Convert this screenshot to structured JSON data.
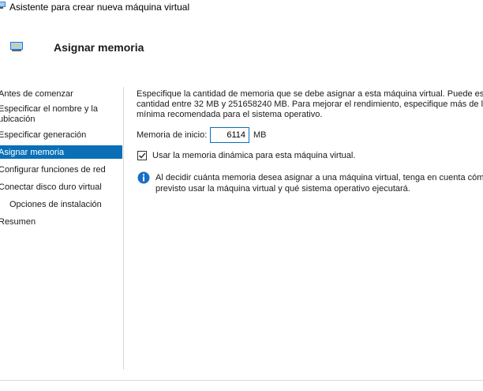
{
  "window": {
    "title": "Asistente para crear nueva máquina virtual"
  },
  "header": {
    "title": "Asignar memoria",
    "icon": "memory-chip-icon"
  },
  "nav": {
    "items": [
      {
        "label": "Antes de comenzar",
        "selected": false
      },
      {
        "label_line1": "Especificar el nombre y la",
        "label_line2": "ubicación",
        "selected": false
      },
      {
        "label": "Especificar generación",
        "selected": false
      },
      {
        "label": "Asignar memoria",
        "selected": true
      },
      {
        "label": "Configurar funciones de red",
        "selected": false
      },
      {
        "label": "Conectar disco duro virtual",
        "selected": false
      },
      {
        "label": "Opciones de instalación",
        "selected": false
      },
      {
        "label": "Resumen",
        "selected": false
      }
    ]
  },
  "main": {
    "description_lines": [
      "Especifique la cantidad de memoria que se debe asignar a esta máquina virtual. Puede espe",
      "cantidad entre 32 MB y 251658240 MB. Para mejorar el rendimiento, especifique más de la c",
      "mínima recomendada para el sistema operativo."
    ],
    "startup_memory_label": "Memoria de inicio:",
    "startup_memory_value": "6114",
    "startup_memory_unit": "MB",
    "dynamic_memory_label": "Usar la memoria dinámica para esta máquina virtual.",
    "dynamic_memory_checked": true,
    "info_lines": [
      "Al decidir cuánta memoria desea asignar a una máquina virtual, tenga en cuenta cómo",
      "previsto usar la máquina virtual y qué sistema operativo ejecutará."
    ]
  },
  "colors": {
    "selection": "#0a6fb7",
    "info_icon": "#1a6fc4"
  }
}
